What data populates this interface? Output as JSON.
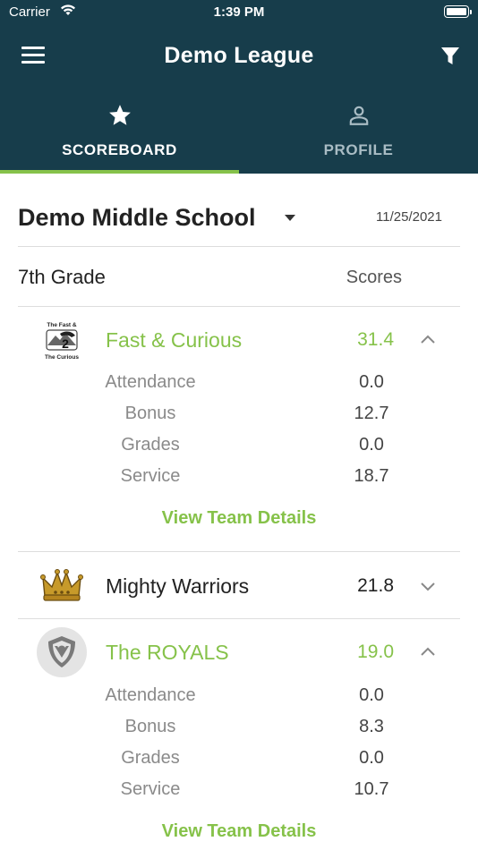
{
  "status_bar": {
    "carrier": "Carrier",
    "time": "1:39 PM"
  },
  "header": {
    "title": "Demo League"
  },
  "tabs": [
    {
      "label": "SCOREBOARD",
      "icon": "star-icon",
      "active": true
    },
    {
      "label": "PROFILE",
      "icon": "person-icon",
      "active": false
    }
  ],
  "school": {
    "name": "Demo Middle School",
    "date": "11/25/2021"
  },
  "grade": {
    "label": "7th Grade",
    "scores_label": "Scores"
  },
  "teams": [
    {
      "logo_text_top": "The Fast &",
      "logo_text_bottom": "The Curious",
      "name": "Fast & Curious",
      "total": "31.4",
      "expanded": true,
      "stats": [
        {
          "label": "Attendance",
          "value": "0.0"
        },
        {
          "label": "Bonus",
          "value": "12.7"
        },
        {
          "label": "Grades",
          "value": "0.0"
        },
        {
          "label": "Service",
          "value": "18.7"
        }
      ],
      "details_label": "View Team Details"
    },
    {
      "name": "Mighty Warriors",
      "total": "21.8",
      "expanded": false
    },
    {
      "name": "The ROYALS",
      "total": "19.0",
      "expanded": true,
      "stats": [
        {
          "label": "Attendance",
          "value": "0.0"
        },
        {
          "label": "Bonus",
          "value": "8.3"
        },
        {
          "label": "Grades",
          "value": "0.0"
        },
        {
          "label": "Service",
          "value": "10.7"
        }
      ],
      "details_label": "View Team Details"
    }
  ],
  "colors": {
    "header_bg": "#173d4b",
    "accent_green": "#86c24a",
    "inactive_tab": "#a9bcc4"
  }
}
